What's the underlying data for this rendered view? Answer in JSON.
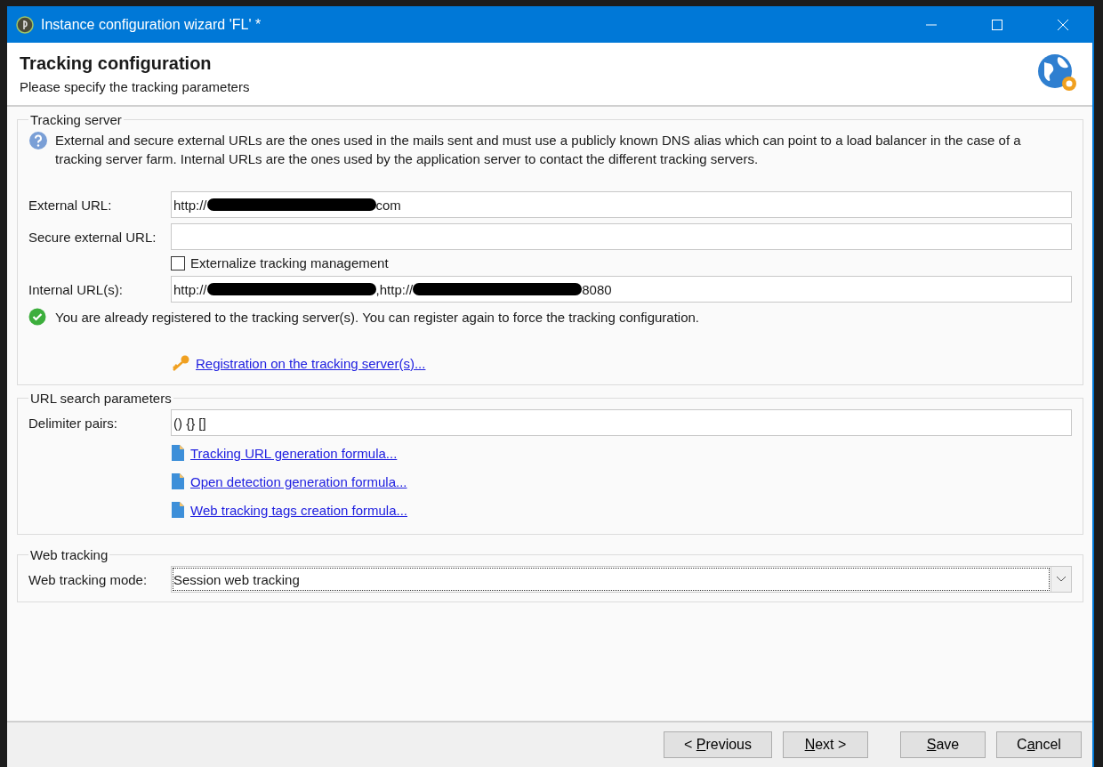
{
  "window": {
    "title": "Instance configuration wizard 'FL' *"
  },
  "header": {
    "title": "Tracking configuration",
    "subtitle": "Please specify the tracking parameters"
  },
  "tracking_server": {
    "legend": "Tracking server",
    "info": "External and secure external URLs are the ones used in the mails sent and must use a publicly known DNS alias which can point to a load balancer in the case of a tracking server farm. Internal URLs are the ones used by the application server to contact the different tracking servers.",
    "external_url": {
      "label": "External URL:",
      "segments": [
        {
          "kind": "text",
          "text": "http://"
        },
        {
          "kind": "redacted"
        },
        {
          "kind": "text",
          "text": "com"
        }
      ]
    },
    "secure_external_url": {
      "label": "Secure external URL:"
    },
    "externalize": {
      "label": "Externalize tracking management",
      "checked": false
    },
    "internal_urls": {
      "label": "Internal URL(s):",
      "segments": [
        {
          "kind": "text",
          "text": "http://"
        },
        {
          "kind": "redacted"
        },
        {
          "kind": "text",
          "text": ",http://"
        },
        {
          "kind": "redacted"
        },
        {
          "kind": "text",
          "text": "8080"
        }
      ]
    },
    "status": "You are already registered to the tracking server(s). You can register again to force the tracking configuration.",
    "register_link": "Registration on the tracking server(s)..."
  },
  "url_search": {
    "legend": "URL search parameters",
    "delimiter": {
      "label": "Delimiter pairs:",
      "value": "() {} []"
    },
    "links": [
      "Tracking URL generation formula...",
      "Open detection generation formula...",
      "Web tracking tags creation formula..."
    ]
  },
  "web_tracking": {
    "legend": "Web tracking",
    "mode": {
      "label": "Web tracking mode:",
      "value": "Session web tracking"
    }
  },
  "buttons": [
    {
      "pre": "< ",
      "key": "P",
      "post": "revious"
    },
    {
      "key": "N",
      "post": "ext >"
    },
    {
      "key": "S",
      "post": "ave"
    },
    {
      "pre": "C",
      "key": "a",
      "post": "ncel"
    }
  ]
}
